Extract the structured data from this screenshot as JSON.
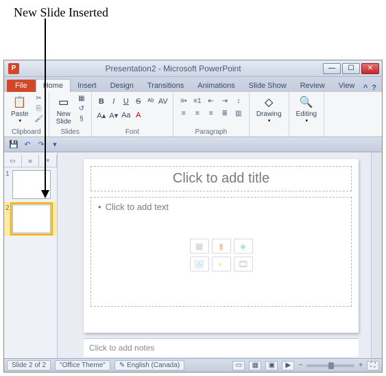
{
  "annotation": "New Slide Inserted",
  "window": {
    "title": "Presentation2 - Microsoft PowerPoint",
    "app_letter": "P"
  },
  "tabs": {
    "file": "File",
    "home": "Home",
    "insert": "Insert",
    "design": "Design",
    "transitions": "Transitions",
    "animations": "Animations",
    "slideshow": "Slide Show",
    "review": "Review",
    "view": "View"
  },
  "ribbon": {
    "clipboard": {
      "label": "Clipboard",
      "paste": "Paste"
    },
    "slides": {
      "label": "Slides",
      "new_slide": "New\nSlide"
    },
    "font": {
      "label": "Font"
    },
    "paragraph": {
      "label": "Paragraph"
    },
    "drawing": {
      "label": "Drawing",
      "btn": "Drawing"
    },
    "editing": {
      "label": "Editing",
      "btn": "Editing"
    }
  },
  "slide_panel": {
    "thumbs": [
      {
        "num": "1",
        "selected": false
      },
      {
        "num": "2",
        "selected": true
      }
    ]
  },
  "placeholders": {
    "title": "Click to add title",
    "body": "Click to add text",
    "notes": "Click to add notes"
  },
  "status": {
    "slide_count": "Slide 2 of 2",
    "theme": "\"Office Theme\"",
    "language": "English (Canada)"
  }
}
